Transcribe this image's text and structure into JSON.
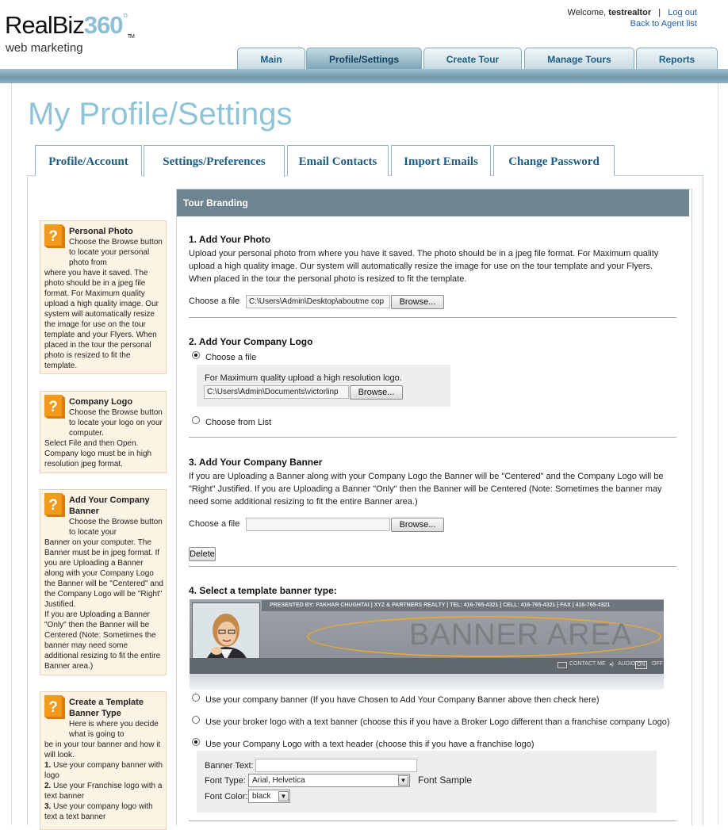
{
  "brand": {
    "name_main": "RealBiz",
    "name_accent": "360",
    "trademark": "°",
    "tagline": "web marketing",
    "tm": "TM"
  },
  "user_bar": {
    "welcome_prefix": "Welcome, ",
    "username": "testrealtor",
    "separator": "|",
    "logout": "Log out",
    "back_link": "Back to Agent list"
  },
  "top_nav": [
    {
      "label": "Main",
      "active": false
    },
    {
      "label": "Profile/Settings",
      "active": true
    },
    {
      "label": "Create Tour",
      "active": false
    },
    {
      "label": "Manage Tours",
      "active": false
    },
    {
      "label": "Reports",
      "active": false
    }
  ],
  "page_title": "My Profile/Settings",
  "sub_tabs": [
    {
      "label": "Profile/Account",
      "active": false
    },
    {
      "label": "Settings/Preferences",
      "active": true
    },
    {
      "label": "Email Contacts",
      "active": false
    },
    {
      "label": "Import Emails",
      "active": false
    },
    {
      "label": "Change Password",
      "active": false
    }
  ],
  "help": [
    {
      "title": "Personal Photo",
      "body_indent": "Choose the Browse button to locate your personal photo from",
      "body": "where you have it saved. The photo should be in a jpeg file format. For Maximum quality upload a high quality image. Our system will automatically resize the image for use on the tour template and your Flyers. When placed in the tour the personal photo is resized to fit the template."
    },
    {
      "title": "Company Logo",
      "body_indent": "Choose the Browse button to locate your logo on your computer.",
      "body": "Select File and then Open. Company logo must be in high resolution jpeg format."
    },
    {
      "title": "Add Your Company Banner",
      "body_indent": "Choose the Browse button to locate your",
      "body": "Banner on your computer. The Banner must be in jpeg format. If you are Uploading a Banner along with your Company Logo the Banner will be \"Centered\" and the Company Logo will be \"Right\" Justified.",
      "body2": "If you are Uploading a Banner \"Only\" then the Banner will be Centered (Note: Sometimes the banner may need some additional resizing to fit the entire Banner area.)"
    },
    {
      "title": "Create a Template Banner Type",
      "body_indent": "Here is where you decide what is going to",
      "body": "be in your tour banner and how it will look.",
      "list": [
        {
          "num": "1.",
          "text": " Use your company banner with logo"
        },
        {
          "num": "2.",
          "text": " Use your Franchise logo with a text banner"
        },
        {
          "num": "3.",
          "text": " Use your company logo with text a text banner"
        }
      ]
    }
  ],
  "panel": {
    "header": "Tour Branding",
    "s1": {
      "title": "1. Add Your Photo",
      "text": "Upload your personal photo from where you have it saved. The photo should be in a jpeg file format. For Maximum quality upload a high quality image. Our system will automatically resize the image for use on the tour template and your Flyers. When placed in the tour the personal photo is resized to fit the template.",
      "file_label": "Choose a file",
      "file_value": "C:\\Users\\Admin\\Desktop\\aboutme cop",
      "browse": "Browse..."
    },
    "s2": {
      "title": "2. Add Your Company Logo",
      "radio1": "Choose a file",
      "hint": "For Maximum quality upload a high resolution logo.",
      "file_value": "C:\\Users\\Admin\\Documents\\victorlinp",
      "browse": "Browse...",
      "radio2": "Choose from List"
    },
    "s3": {
      "title": "3. Add Your Company Banner",
      "text": "If you are Uploading a Banner along with your Company Logo the Banner will be \"Centered\" and the Company Logo will be \"Right\" Justified. If you are Uploading a Banner \"Only\" then the Banner will be Centered (Note: Sometimes the banner may need some additional resizing to fit the entire Banner area.)",
      "file_label": "Choose a file",
      "file_value": "",
      "browse": "Browse...",
      "delete": "Delete"
    },
    "s4": {
      "title": "4. Select a template banner type:",
      "banner_strip": "PRESENTED BY: FAKHAR CHUGHTAI   |   XYZ & PARTNERS REALTY   |   TEL: 416-765-4321   |   CELL: 416-765-4321   |   FAX   |   416-765-4321",
      "banner_area": "BANNER AREA",
      "contact": "CONTACT ME",
      "audio": "AUDIO",
      "on": "ON",
      "off": "OFF",
      "opt1": "Use your company banner (If you have Chosen to Add Your Company Banner above then check here)",
      "opt2": "Use your broker logo with a text banner (choose this if you have a Broker Logo different than a franchise company Logo)",
      "opt3": "Use your Company Logo with a text header (choose this if you have a franchise logo)",
      "banner_text_label": "Banner Text:",
      "banner_text_value": "",
      "font_type_label": "Font Type:",
      "font_type_value": "Arial, Helvetica",
      "font_sample": "Font Sample",
      "font_color_label": "Font Color:",
      "font_color_value": "black"
    }
  },
  "colors": {
    "accent": "#8ec4d6",
    "tab_text": "#1b5f86",
    "panel_header": "#6e848f",
    "help_bg": "#fdf3e4",
    "help_icon": "#f29a1c",
    "banner_ellipse": "#e8a43d"
  }
}
